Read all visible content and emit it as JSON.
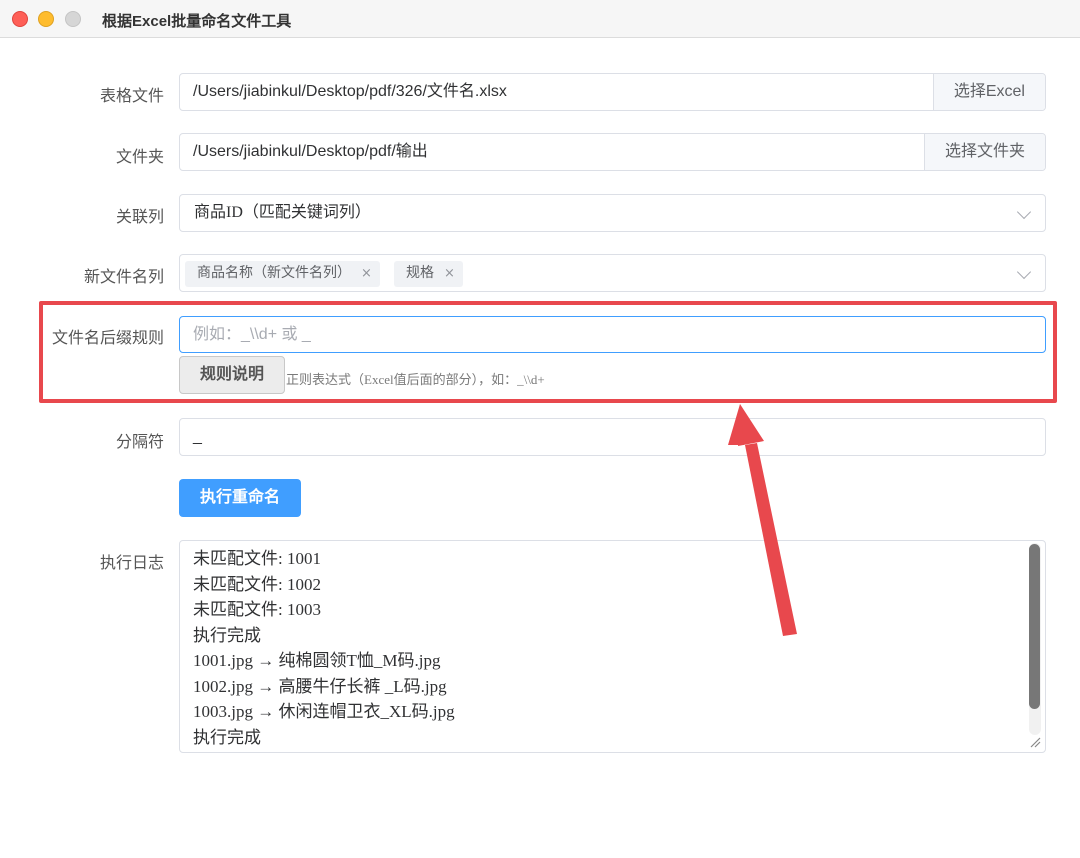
{
  "window": {
    "title": "根据Excel批量命名文件工具"
  },
  "form": {
    "excel": {
      "label": "表格文件",
      "value": "/Users/jiabinkul/Desktop/pdf/326/文件名.xlsx",
      "button": "选择Excel"
    },
    "folder": {
      "label": "文件夹",
      "value": "/Users/jiabinkul/Desktop/pdf/输出",
      "button": "选择文件夹"
    },
    "key_column": {
      "label": "关联列",
      "value": "商品ID（匹配关键词列）"
    },
    "new_name": {
      "label": "新文件名列",
      "tags": [
        "商品名称（新文件名列）",
        "规格"
      ],
      "tag_close": "×"
    },
    "suffix_rule": {
      "label": "文件名后缀规则",
      "placeholder": "例如：_\\\\d+ 或 _",
      "button": "规则说明",
      "hint": "正则表达式（Excel值后面的部分），如：_\\\\d+"
    },
    "separator": {
      "label": "分隔符",
      "value": "_"
    },
    "run_button": "执行重命名",
    "log": {
      "label": "执行日志",
      "lines": [
        "未匹配文件: 1001",
        "未匹配文件: 1002",
        "未匹配文件: 1003",
        "执行完成",
        "1001.jpg → 纯棉圆领T恤_M码.jpg",
        "1002.jpg → 高腰牛仔长裤 _L码.jpg",
        "1003.jpg → 休闲连帽卫衣_XL码.jpg",
        "执行完成"
      ]
    }
  },
  "colors": {
    "primary": "#409eff",
    "highlight": "#e8484d"
  }
}
